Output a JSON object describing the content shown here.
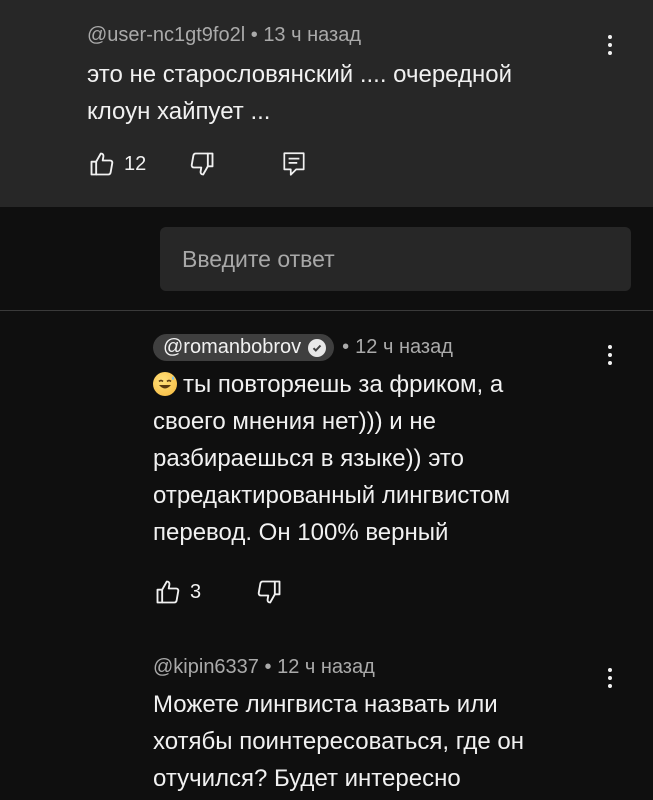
{
  "comments": [
    {
      "author": "@user-nc1gt9fo2l",
      "time": "13 ч назад",
      "text_lines": [
        "это не старословянский .... очередной",
        "клоун хайпует ..."
      ],
      "likes": "12"
    },
    {
      "author": "@romanbobrov",
      "time": "12 ч назад",
      "verified": true,
      "emoji": "grinning-sweat-emoji",
      "text_lines": [
        "ты повторяешь за фриком, а",
        "своего мнения нет))) и не",
        "разбираешься в языке)) это",
        "отредактированный лингвистом",
        "перевод. Он 100% верный"
      ],
      "likes": "3"
    },
    {
      "author": "@kipin6337",
      "time": "12 ч назад",
      "text_lines": [
        "Можете лингвиста назвать или",
        "хотябы поинтересоваться, где он",
        "отучился? Будет интересно"
      ]
    }
  ],
  "reply": {
    "placeholder": "Введите ответ"
  },
  "separator": "•",
  "colors": {
    "background": "#0f0f0f",
    "highlight_bg": "#272727",
    "meta_text": "#aaaaaa",
    "text": "#f1f1f1"
  }
}
